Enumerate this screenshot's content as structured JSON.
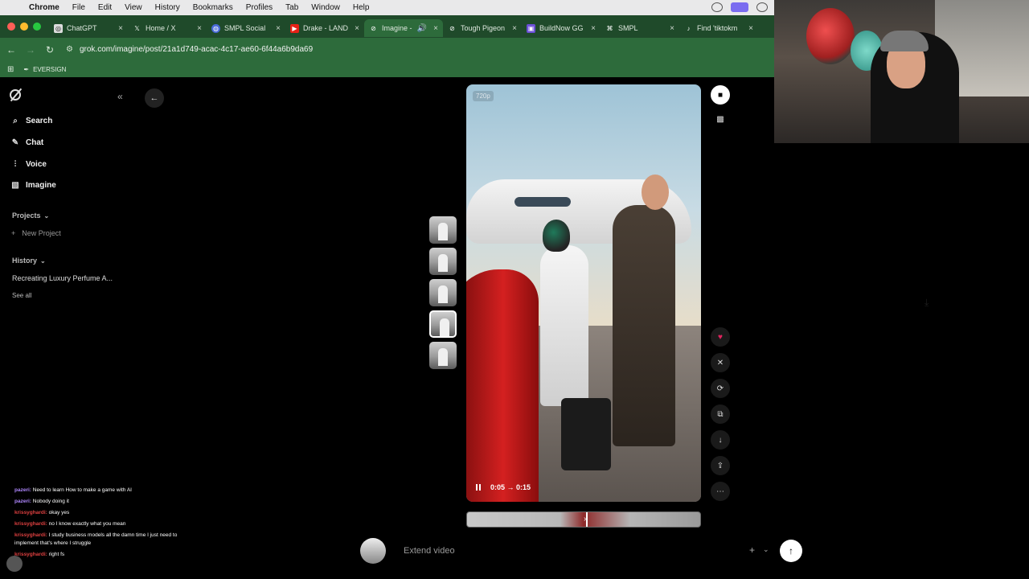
{
  "menubar": {
    "app": "Chrome",
    "items": [
      "File",
      "Edit",
      "View",
      "History",
      "Bookmarks",
      "Profiles",
      "Tab",
      "Window",
      "Help"
    ]
  },
  "tabs": [
    {
      "title": "ChatGPT",
      "icon": "chatgpt-icon"
    },
    {
      "title": "Home / X",
      "icon": "x-logo-icon"
    },
    {
      "title": "SMPL Social",
      "icon": "globe-icon"
    },
    {
      "title": "Drake - LAND",
      "icon": "youtube-icon"
    },
    {
      "title": "Imagine -",
      "icon": "grok-icon",
      "active": true
    },
    {
      "title": "Tough Pigeon",
      "icon": "grok-icon"
    },
    {
      "title": "BuildNow GG",
      "icon": "app-icon"
    },
    {
      "title": "SMPL",
      "icon": "brand-icon"
    },
    {
      "title": "Find 'tiktokm",
      "icon": "tiktok-icon"
    }
  ],
  "address": {
    "url": "grok.com/imagine/post/21a1d749-acac-4c17-ae60-6f44a6b9da69"
  },
  "bookmarks": {
    "items": [
      "EVERSIGN"
    ]
  },
  "sidebar": {
    "nav": [
      {
        "label": "Search",
        "icon": "search-icon"
      },
      {
        "label": "Chat",
        "icon": "chat-icon"
      },
      {
        "label": "Voice",
        "icon": "voice-icon"
      },
      {
        "label": "Imagine",
        "icon": "image-icon"
      }
    ],
    "projects_label": "Projects",
    "new_project": "New Project",
    "history_label": "History",
    "history_items": [
      "Recreating Luxury Perfume A..."
    ],
    "see_all": "See all"
  },
  "chat_overlay": [
    {
      "user": "pazeri:",
      "text": "Need to learn How to make a game with AI",
      "color": "u1"
    },
    {
      "user": "pazeri:",
      "text": "Nobody doing it",
      "color": "u1"
    },
    {
      "user": "krissyghardi:",
      "text": "okay yes",
      "color": "u2"
    },
    {
      "user": "krissyghardi:",
      "text": "no I know exactly what you mean",
      "color": "u2"
    },
    {
      "user": "krissyghardi:",
      "text": "I study business models all the damn time I just need to implement that's where I struggle",
      "color": "u2"
    },
    {
      "user": "krissyghardi:",
      "text": "right fs",
      "color": "u2"
    }
  ],
  "video": {
    "resolution": "720p",
    "current_time": "0:05",
    "arrow": "→",
    "duration": "0:15"
  },
  "composer": {
    "placeholder": "Extend video"
  },
  "colors": {
    "accent_green": "#2d6b3b",
    "heart": "#e0245e"
  }
}
